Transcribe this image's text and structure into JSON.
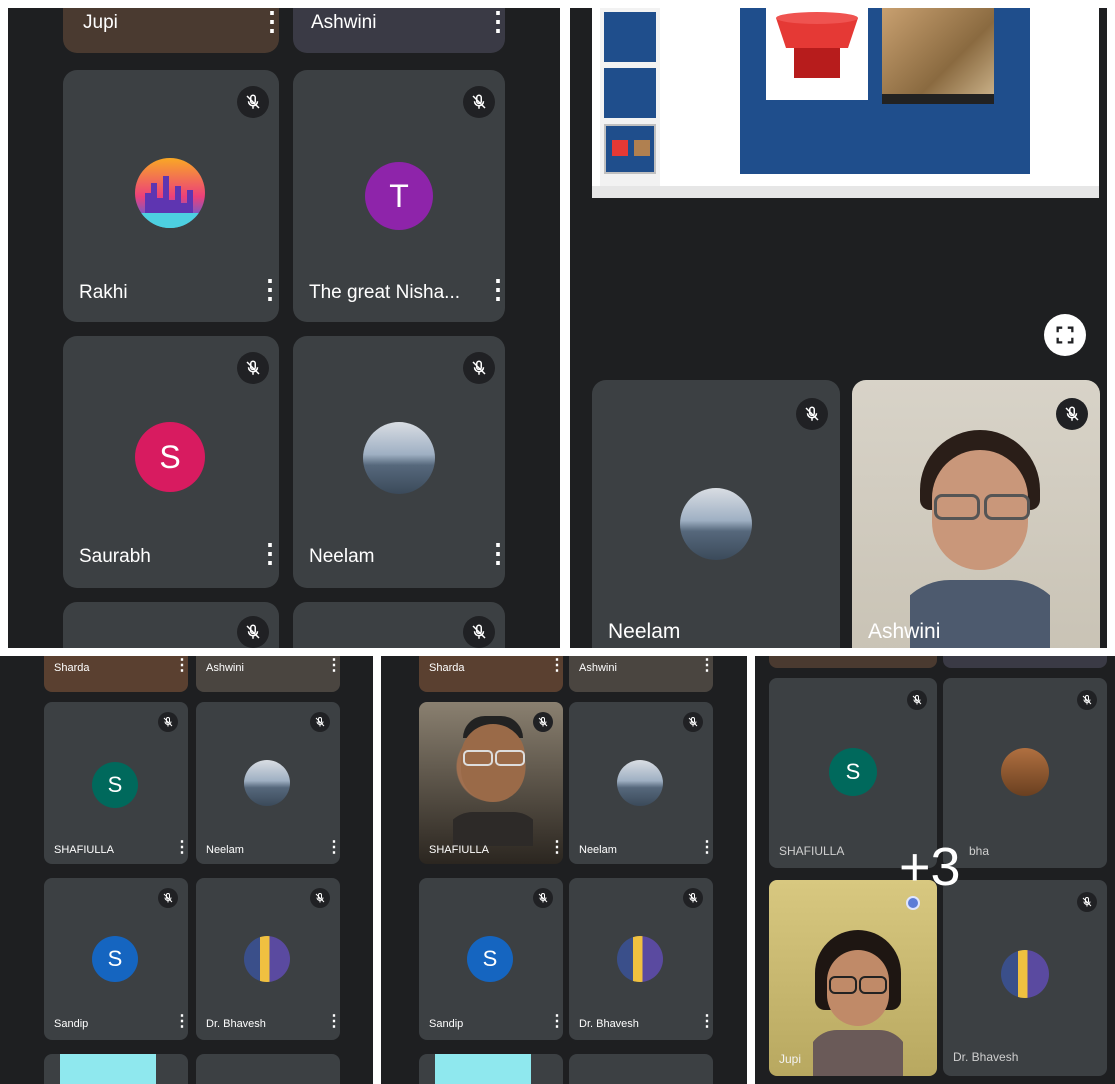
{
  "colors": {
    "tile": "#3c4043",
    "panel": "#1e1f21",
    "avatar_purple": "#8e24aa",
    "avatar_pink": "#d81b60",
    "avatar_green": "#00695c",
    "avatar_blue": "#1565c0"
  },
  "icons": {
    "mute": "mic-off-icon",
    "more": "more-vert-icon",
    "fullscreen": "fullscreen-icon"
  },
  "more_glyph": "⋮",
  "p1": {
    "top": {
      "left": "Jupi",
      "right": "Ashwini"
    },
    "tiles": [
      {
        "name": "Rakhi",
        "avatar": "city-skyline"
      },
      {
        "name": "The great Nisha...",
        "initial": "T"
      },
      {
        "name": "Saurabh",
        "initial": "S"
      },
      {
        "name": "Neelam",
        "avatar": "ocean-photo"
      }
    ]
  },
  "p2": {
    "tiles": [
      {
        "name": "Neelam"
      },
      {
        "name": "Ashwini"
      }
    ]
  },
  "p3": {
    "top": {
      "left": "Sharda",
      "right": "Ashwini"
    },
    "tiles": [
      {
        "name": "SHAFIULLA",
        "initial": "S"
      },
      {
        "name": "Neelam"
      },
      {
        "name": "Sandip",
        "initial": "S"
      },
      {
        "name": "Dr. Bhavesh"
      }
    ]
  },
  "p4": {
    "top": {
      "left": "Sharda",
      "right": "Ashwini"
    },
    "tiles": [
      {
        "name": "SHAFIULLA"
      },
      {
        "name": "Neelam"
      },
      {
        "name": "Sandip",
        "initial": "S"
      },
      {
        "name": "Dr. Bhavesh"
      }
    ]
  },
  "p5": {
    "tiles": [
      {
        "name": "SHAFIULLA",
        "initial": "S"
      },
      {
        "name": "bha"
      },
      {
        "name": "Jupi"
      },
      {
        "name": "Dr. Bhavesh"
      }
    ],
    "overflow_count": "+3"
  }
}
